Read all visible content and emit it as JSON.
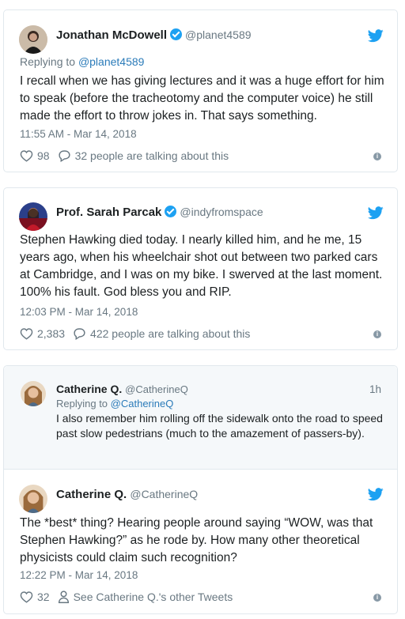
{
  "tweets": [
    {
      "author": "Jonathan McDowell",
      "handle": "@planet4589",
      "reply_prefix": "Replying to ",
      "reply_to": "@planet4589",
      "text": "I recall when we has giving lectures and it was a huge effort for him to speak (before the tracheotomy and the computer voice) he still made the effort to throw jokes in. That says something.",
      "timestamp": "11:55 AM - Mar 14, 2018",
      "likes": "98",
      "talking": "32 people are talking about this"
    },
    {
      "author": "Prof. Sarah Parcak",
      "handle": "@indyfromspace",
      "text": "Stephen Hawking died today. I nearly killed him, and he me, 15 years ago, when his wheelchair shot out between two parked cars at Cambridge, and I was on my bike. I swerved at the last moment. 100% his fault. God bless you and RIP.",
      "timestamp": "12:03 PM - Mar 14, 2018",
      "likes": "2,383",
      "talking": "422 people are talking about this"
    }
  ],
  "thread": {
    "parent": {
      "author": "Catherine Q.",
      "handle": "@CatherineQ",
      "age": "1h",
      "reply_prefix": "Replying to ",
      "reply_to": "@CatherineQ",
      "text": "I also remember him rolling off the sidewalk onto the road to speed past slow pedestrians (much to the amazement of passers-by)."
    },
    "main": {
      "author": "Catherine Q.",
      "handle": "@CatherineQ",
      "text": "The *best* thing? Hearing people around saying “WOW, was that Stephen Hawking?” as he rode by. How many other theoretical physicists could claim such recognition?",
      "timestamp": "12:22 PM - Mar 14, 2018",
      "likes": "32",
      "profile_link": "See Catherine Q.'s other Tweets"
    }
  },
  "icons": {
    "bird": "twitter-bird-icon",
    "heart": "heart-icon",
    "bubble": "speech-bubble-icon",
    "person": "person-icon",
    "info": "info-icon"
  },
  "colors": {
    "twitter_blue": "#1da1f2",
    "link": "#2b7bb9",
    "muted": "#697882",
    "border": "#e1e8ed",
    "thread_bg": "#f5f8fa"
  }
}
